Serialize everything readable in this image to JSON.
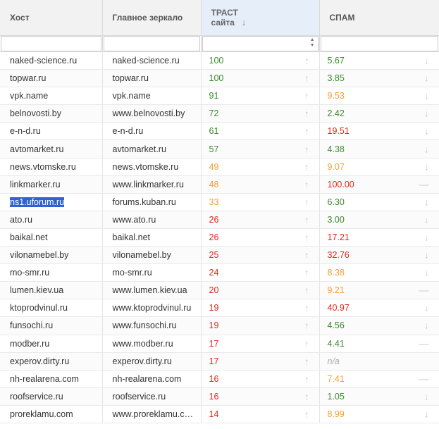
{
  "columns": {
    "host": "Хост",
    "mirror": "Главное зеркало",
    "trust_line1": "ТРАСТ",
    "trust_line2": "сайта",
    "spam": "СПАМ"
  },
  "colors": {
    "green": "#3c8c2d",
    "orange": "#f0a037",
    "red": "#e2281c",
    "na": "#aaaaaa",
    "selection": "#2f62d2"
  },
  "rows": [
    {
      "host": "naked-science.ru",
      "mirror": "naked-science.ru",
      "trust": "100",
      "trust_color": "green",
      "spam": "5.67",
      "spam_color": "green",
      "trust_icon": "arrow-up-icon",
      "spam_icon": "arrow-down-icon"
    },
    {
      "host": "topwar.ru",
      "mirror": "topwar.ru",
      "trust": "100",
      "trust_color": "green",
      "spam": "3.85",
      "spam_color": "green",
      "trust_icon": "arrow-up-icon",
      "spam_icon": "arrow-down-icon"
    },
    {
      "host": "vpk.name",
      "mirror": "vpk.name",
      "trust": "91",
      "trust_color": "green",
      "spam": "9.53",
      "spam_color": "orange",
      "trust_icon": "arrow-up-icon",
      "spam_icon": "arrow-down-icon"
    },
    {
      "host": "belnovosti.by",
      "mirror": "www.belnovosti.by",
      "trust": "72",
      "trust_color": "green",
      "spam": "2.42",
      "spam_color": "green",
      "trust_icon": "arrow-up-icon",
      "spam_icon": "arrow-down-icon"
    },
    {
      "host": "e-n-d.ru",
      "mirror": "e-n-d.ru",
      "trust": "61",
      "trust_color": "green",
      "spam": "19.51",
      "spam_color": "red",
      "trust_icon": "arrow-up-icon",
      "spam_icon": "arrow-down-icon"
    },
    {
      "host": "avtomarket.ru",
      "mirror": "avtomarket.ru",
      "trust": "57",
      "trust_color": "green",
      "spam": "4.38",
      "spam_color": "green",
      "trust_icon": "arrow-up-icon",
      "spam_icon": "arrow-down-icon"
    },
    {
      "host": "news.vtomske.ru",
      "mirror": "news.vtomske.ru",
      "trust": "49",
      "trust_color": "orange",
      "spam": "9.07",
      "spam_color": "orange",
      "trust_icon": "arrow-up-icon",
      "spam_icon": "arrow-down-icon"
    },
    {
      "host": "linkmarker.ru",
      "mirror": "www.linkmarker.ru",
      "trust": "48",
      "trust_color": "orange",
      "spam": "100.00",
      "spam_color": "red",
      "trust_icon": "arrow-up-icon",
      "spam_icon": "dash-icon"
    },
    {
      "host": "ns1.uforum.ru",
      "mirror": "forums.kuban.ru",
      "trust": "33",
      "trust_color": "orange",
      "spam": "6.30",
      "spam_color": "green",
      "trust_icon": "arrow-up-icon",
      "spam_icon": "arrow-down-icon",
      "selected": true
    },
    {
      "host": "ato.ru",
      "mirror": "www.ato.ru",
      "trust": "26",
      "trust_color": "red",
      "spam": "3.00",
      "spam_color": "green",
      "trust_icon": "arrow-up-icon",
      "spam_icon": "arrow-down-icon"
    },
    {
      "host": "baikal.net",
      "mirror": "baikal.net",
      "trust": "26",
      "trust_color": "red",
      "spam": "17.21",
      "spam_color": "red",
      "trust_icon": "arrow-up-icon",
      "spam_icon": "arrow-down-icon"
    },
    {
      "host": "vilonamebel.by",
      "mirror": "vilonamebel.by",
      "trust": "25",
      "trust_color": "red",
      "spam": "32.76",
      "spam_color": "red",
      "trust_icon": "arrow-up-icon",
      "spam_icon": "arrow-down-icon"
    },
    {
      "host": "mo-smr.ru",
      "mirror": "mo-smr.ru",
      "trust": "24",
      "trust_color": "red",
      "spam": "8.38",
      "spam_color": "orange",
      "trust_icon": "arrow-up-icon",
      "spam_icon": "arrow-down-icon"
    },
    {
      "host": "lumen.kiev.ua",
      "mirror": "www.lumen.kiev.ua",
      "trust": "20",
      "trust_color": "red",
      "spam": "9.21",
      "spam_color": "orange",
      "trust_icon": "arrow-up-icon",
      "spam_icon": "dash-icon"
    },
    {
      "host": "ktoprodvinul.ru",
      "mirror": "www.ktoprodvinul.ru",
      "trust": "19",
      "trust_color": "red",
      "spam": "40.97",
      "spam_color": "red",
      "trust_icon": "arrow-up-icon",
      "spam_icon": "arrow-down-icon"
    },
    {
      "host": "funsochi.ru",
      "mirror": "www.funsochi.ru",
      "trust": "19",
      "trust_color": "red",
      "spam": "4.56",
      "spam_color": "green",
      "trust_icon": "arrow-up-icon",
      "spam_icon": "arrow-down-icon"
    },
    {
      "host": "modber.ru",
      "mirror": "www.modber.ru",
      "trust": "17",
      "trust_color": "red",
      "spam": "4.41",
      "spam_color": "green",
      "trust_icon": "arrow-up-icon",
      "spam_icon": "dash-icon"
    },
    {
      "host": "experov.dirty.ru",
      "mirror": "experov.dirty.ru",
      "trust": "17",
      "trust_color": "red",
      "spam": "n/a",
      "spam_color": "na",
      "trust_icon": "arrow-up-icon",
      "spam_icon": "none"
    },
    {
      "host": "nh-realarena.com",
      "mirror": "nh-realarena.com",
      "trust": "16",
      "trust_color": "red",
      "spam": "7.41",
      "spam_color": "orange",
      "trust_icon": "arrow-up-icon",
      "spam_icon": "dash-icon"
    },
    {
      "host": "roofservice.ru",
      "mirror": "roofservice.ru",
      "trust": "16",
      "trust_color": "red",
      "spam": "1.05",
      "spam_color": "green",
      "trust_icon": "arrow-up-icon",
      "spam_icon": "arrow-down-icon"
    },
    {
      "host": "proreklamu.com",
      "mirror": "www.proreklamu.c…",
      "trust": "14",
      "trust_color": "red",
      "spam": "8.99",
      "spam_color": "orange",
      "trust_icon": "arrow-up-icon",
      "spam_icon": "arrow-down-icon"
    }
  ]
}
